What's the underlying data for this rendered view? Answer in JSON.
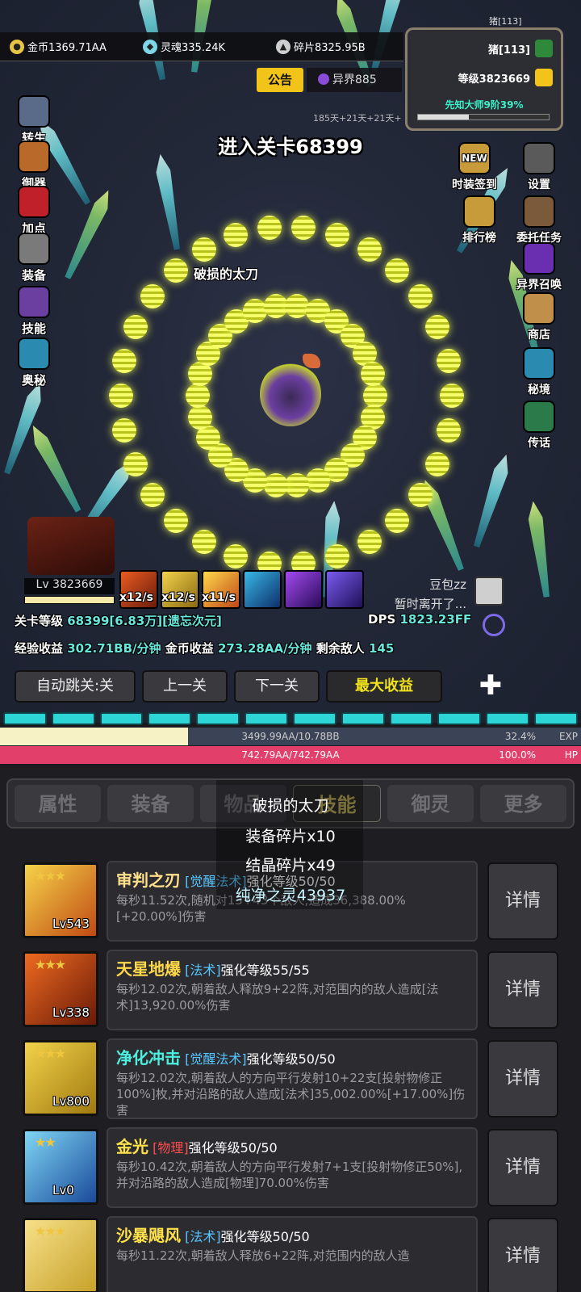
{
  "resources": {
    "gold": "金币1369.71AA",
    "soul": "灵魂335.24K",
    "shard": "碎片8325.95B"
  },
  "notice_label": "公告",
  "realm_label": "异界885",
  "player": {
    "name_small": "猪[113]",
    "name": "猪[113]",
    "level": "等级3823669",
    "title_progress": "先知大师9阶39%",
    "title_progress_fraction": 0.39
  },
  "day_timer": "185天+21天+21天+",
  "left_menu": [
    "转生",
    "御器",
    "加点",
    "装备",
    "技能",
    "奥秘"
  ],
  "right_menu": [
    "时装签到",
    "设置",
    "排行榜",
    "委托任务",
    "异界召唤",
    "商店",
    "秘境",
    "传话"
  ],
  "new_badge": "NEW",
  "stage_title": "进入关卡68399",
  "drop_item_label": "破损的太刀",
  "boss": {
    "level": "Lv 3823669"
  },
  "skill_rates": [
    "x12/s",
    "x12/s",
    "x11/s"
  ],
  "friend": {
    "name": "豆包zz",
    "status": "暂时离开了..."
  },
  "stats": {
    "stage_level_label": "关卡等级",
    "stage_level_value": "68399[6.83万][遗忘次元]",
    "dps_label": "DPS",
    "dps_value": "1823.23FF",
    "exp_income_label": "经验收益",
    "exp_income_value": "302.71BB/分钟",
    "gold_income_label": "金币收益",
    "gold_income_value": "273.28AA/分钟",
    "enemies_label": "剩余敌人",
    "enemies_value": "145"
  },
  "controls": {
    "auto_skip": "自动跳关:关",
    "prev": "上一关",
    "next": "下一关",
    "max_income": "最大收益",
    "plus": "✚"
  },
  "exp_bar": {
    "text": "3499.99AA/10.78BB",
    "percent": "32.4%",
    "tag": "EXP",
    "fraction": 0.324
  },
  "hp_bar": {
    "text": "742.79AA/742.79AA",
    "percent": "100.0%",
    "tag": "HP",
    "fraction": 1.0
  },
  "tabs": [
    "属性",
    "装备",
    "物品",
    "技能",
    "御灵",
    "更多"
  ],
  "active_tab": 3,
  "loot_popup": [
    "破损的太刀",
    "装备碎片x10",
    "结晶碎片x49",
    "纯净之灵43937"
  ],
  "skills": [
    {
      "name": "审判之刃",
      "type": "[觉醒法术]",
      "level_text": "强化等级50/50",
      "desc": "每秒11.52次,随机对13+43个敌人,造成36,388.00%[+20.00%]伤害",
      "lv": "Lv543",
      "stars": "★★★",
      "color": "#ffe08a"
    },
    {
      "name": "天星地爆",
      "type": "[法术]",
      "level_text": "强化等级55/55",
      "desc": "每秒12.02次,朝着敌人释放9+22阵,对范围内的敌人造成[法术]13,920.00%伤害",
      "lv": "Lv338",
      "stars": "★★★",
      "color": "#ffd84a"
    },
    {
      "name": "净化冲击",
      "type": "[觉醒法术]",
      "level_text": "强化等级50/50",
      "desc": "每秒12.02次,朝着敌人的方向平行发射10+22支[投射物修正100%]枚,并对沿路的敌人造成[法术]35,002.00%[+17.00%]伤害",
      "lv": "Lv800",
      "stars": "★★★",
      "color": "#4cf0e0"
    },
    {
      "name": "金光",
      "type": "[物理]",
      "level_text": "强化等级50/50",
      "desc": "每秒10.42次,朝着敌人的方向平行发射7+1支[投射物修正50%],并对沿路的敌人造成[物理]70.00%伤害",
      "lv": "Lv0",
      "stars": "★★",
      "color": "#ffe24a"
    },
    {
      "name": "沙暴飓风",
      "type": "[法术]",
      "level_text": "强化等级50/50",
      "desc": "每秒11.22次,朝着敌人释放6+22阵,对范围内的敌人造",
      "lv": "",
      "stars": "★★★",
      "color": "#ffe24a"
    }
  ],
  "detail_label": "详情"
}
